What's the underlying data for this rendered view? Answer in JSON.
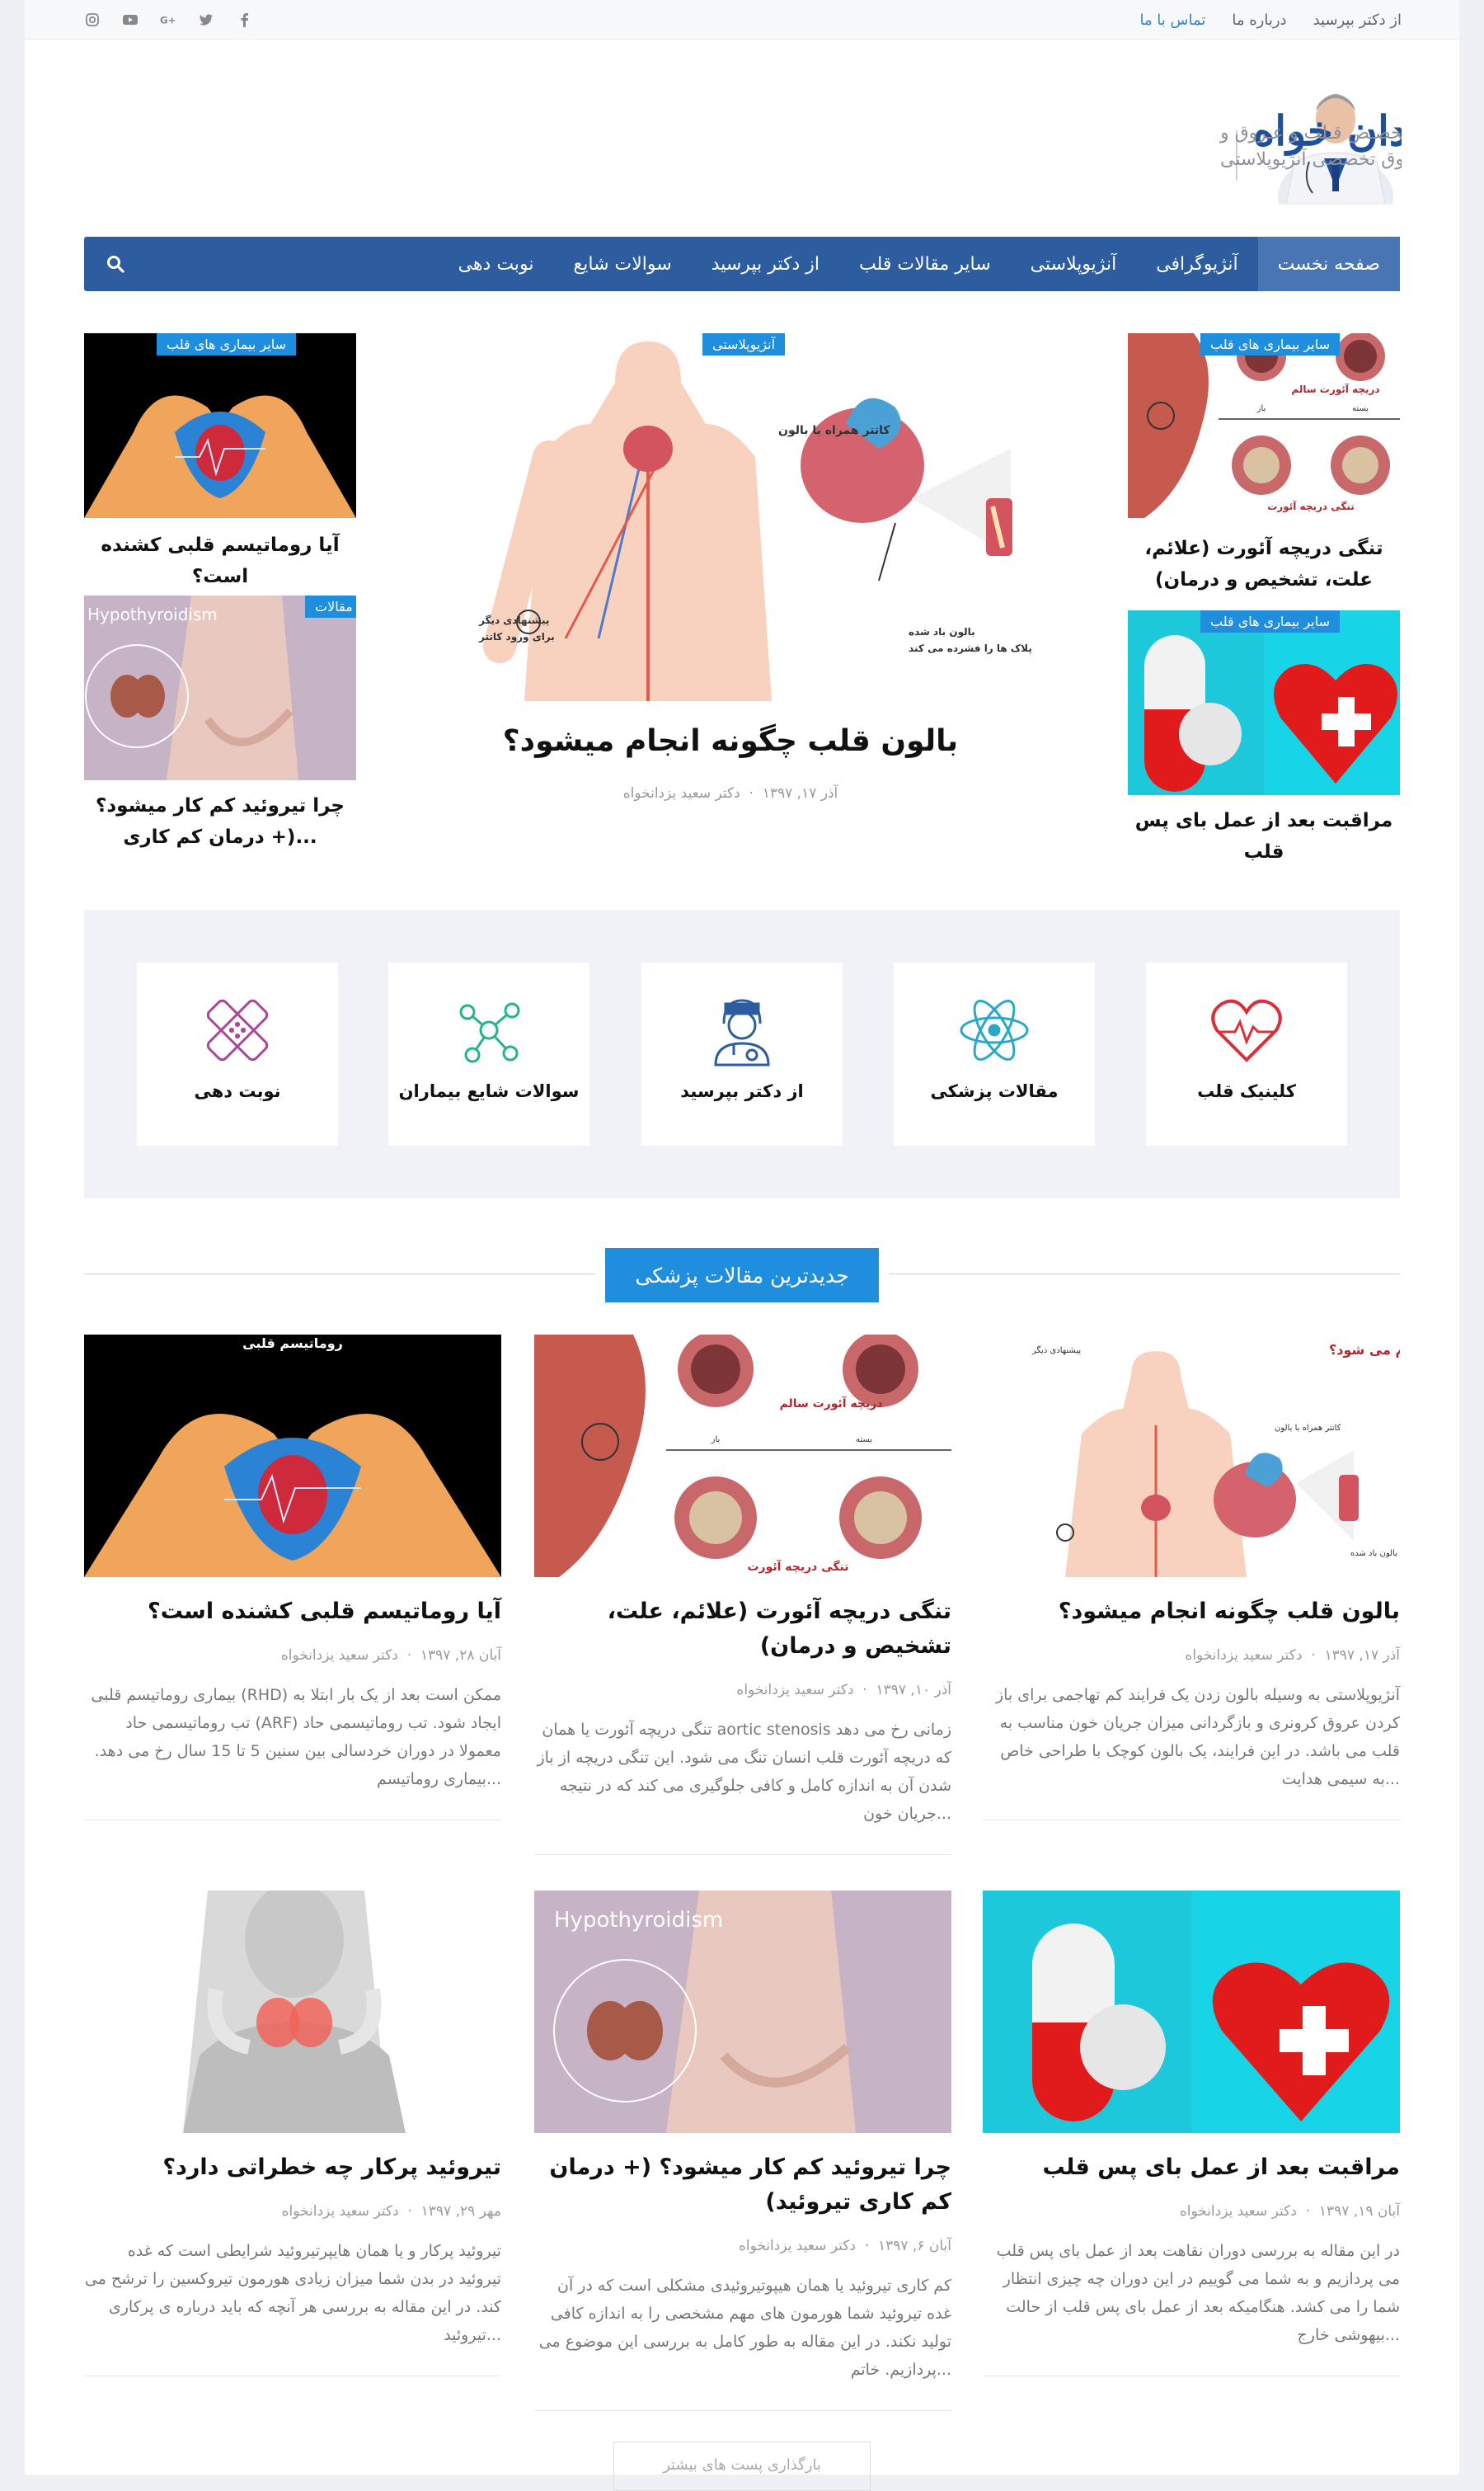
{
  "topbar": {
    "links": [
      "از دکتر بپرسید",
      "درباره ما",
      "تماس با ما"
    ],
    "social_icons": [
      "instagram-icon",
      "youtube-icon",
      "google-plus-icon",
      "twitter-icon",
      "facebook-icon"
    ]
  },
  "logo": {
    "name": "دکتر سعید یزدان خواه",
    "line1": "فــوق تخصـص قـلب و عـروق و",
    "line2": "فلوشیپ فوق تخصصی آنژیوپلاستی"
  },
  "nav": {
    "items": [
      "صفحه نخست",
      "آنژیوگرافی",
      "آنژیوپلاستی",
      "سایر مقالات قلب",
      "از دکتر بپرسید",
      "سوالات شایع",
      "نوبت دهی"
    ],
    "active": "صفحه نخست"
  },
  "featured": {
    "main": {
      "tag": "آنژیوپلاستی",
      "title": "بالون قلب چگونه انجام میشود؟",
      "author": "دکتر سعید یزدانخواه",
      "date": "آذر ۱۷, ۱۳۹۷",
      "labels": [
        "کاتتر همراه با بالون",
        "بالون باد شده",
        "پلاک ها را فشرده می کند",
        "پیشنهادی دیگر",
        "برای ورود کاتتر"
      ]
    },
    "right": [
      {
        "tag": "سایر بیماری های قلب",
        "title": "تنگی دریچه آئورت (علائم، علت، تشخیص و درمان)",
        "labels": [
          "دریچه آئورت سالم",
          "باز",
          "بسته",
          "تنگی دریچه آئورت"
        ]
      },
      {
        "tag": "سایر بیماری های قلب",
        "title": "مراقبت بعد از عمل بای پس قلب"
      }
    ],
    "left": [
      {
        "tag": "سایر بیماری های قلب",
        "title": "آیا روماتیسم قلبی کشنده است؟"
      },
      {
        "tag": "مقالات",
        "title": "چرا تیروئید کم کار میشود؟ (+ درمان کم کاری...",
        "label": "Hypothyroidism"
      }
    ]
  },
  "services": [
    {
      "label": "کلینیک قلب",
      "icon": "heart-pulse-icon",
      "color": "#d9303a"
    },
    {
      "label": "مقالات پزشکی",
      "icon": "atom-icon",
      "color": "#2aa8c8"
    },
    {
      "label": "از دکتر بپرسید",
      "icon": "doctor-icon",
      "color": "#2d5c9f"
    },
    {
      "label": "سوالات شایع بیماران",
      "icon": "molecule-icon",
      "color": "#25b38c"
    },
    {
      "label": "نوبت دهی",
      "icon": "bandage-icon",
      "color": "#a9489a"
    }
  ],
  "section_title": "جدیدترین مقالات پزشکی",
  "articles": [
    {
      "title": "بالون قلب چگونه انجام میشود؟",
      "author": "دکتر سعید یزدانخواه",
      "date": "آذر ۱۷, ۱۳۹۷",
      "excerpt": "آنژیوپلاستی به وسیله بالون زدن یک فرایند کم تهاجمی برای باز کردن عروق کرونری و بازگردانی میزان جریان خون مناسب به قلب می باشد. در این فرایند، یک بالون کوچک با طراحی خاص به سیمی هدایت...",
      "img_title": "بالون زدن قلب چگونه انجام می شود؟",
      "img_labels": [
        "پیشنهادی دیگر",
        "کاتتر همراه با بالون",
        "بالون باد شده"
      ]
    },
    {
      "title": "تنگی دریچه آئورت (علائم، علت، تشخیص و درمان)",
      "author": "دکتر سعید یزدانخواه",
      "date": "آذر ۱۰, ۱۳۹۷",
      "excerpt": "تنگی دریچه آئورت یا همان aortic stenosis زمانی رخ می دهد که دریچه آئورت قلب انسان تنگ می شود. این تنگی دریچه از باز شدن آن به اندازه کامل و کافی جلوگیری می کند که در نتیجه جریان خون...",
      "img_labels": [
        "دریچه آئورت سالم",
        "باز",
        "بسته",
        "تنگی دریچه آئورت"
      ]
    },
    {
      "title": "آیا روماتیسم قلبی کشنده است؟",
      "author": "دکتر سعید یزدانخواه",
      "date": "آبان ۲۸, ۱۳۹۷",
      "excerpt": "بیماری روماتیسم قلبی (RHD) ممکن است بعد از یک بار ابتلا به تب روماتیسمی حاد (ARF) ایجاد شود. تب روماتیسمی حاد معمولا در دوران خردسالی بین سنین 5 تا 15 سال رخ می دهد. بیماری روماتیسم...",
      "img_title": "روماتیسم قلبی"
    },
    {
      "title": "مراقبت بعد از عمل بای پس قلب",
      "author": "دکتر سعید یزدانخواه",
      "date": "آبان ۱۹, ۱۳۹۷",
      "excerpt": "در این مقاله به بررسی دوران نقاهت بعد از عمل بای پس قلب می پردازیم و به شما می گوییم در این دوران چه چیزی انتظار شما را می کشد. هنگامیکه بعد از عمل بای پس قلب از حالت بیهوشی خارج..."
    },
    {
      "title": "چرا تیروئید کم کار میشود؟ (+ درمان کم کاری تیروئید)",
      "author": "دکتر سعید یزدانخواه",
      "date": "آبان ۶, ۱۳۹۷",
      "excerpt": "کم کاری تیروئید یا همان هیپوتیروئیدی مشکلی است که در آن غده تیروئید شما هورمون های مهم مشخصی را به اندازه کافی تولید نکند. در این مقاله به طور کامل به بررسی این موضوع می پردازیم. خاتم...",
      "img_title": "Hypothyroidism"
    },
    {
      "title": "تیروئید پرکار چه خطراتی دارد؟",
      "author": "دکتر سعید یزدانخواه",
      "date": "مهر ۲۹, ۱۳۹۷",
      "excerpt": "تیروئید پرکار و یا همان هایپرتیروئید شرایطی است که غده تیروئید در بدن شما میزان زیادی هورمون تیروکسین را ترشح می کند. در این مقاله به بررسی هر آنچه که باید درباره ی پرکاری تیروئید..."
    }
  ],
  "pager": "بارگذاری پست های بیشتر"
}
